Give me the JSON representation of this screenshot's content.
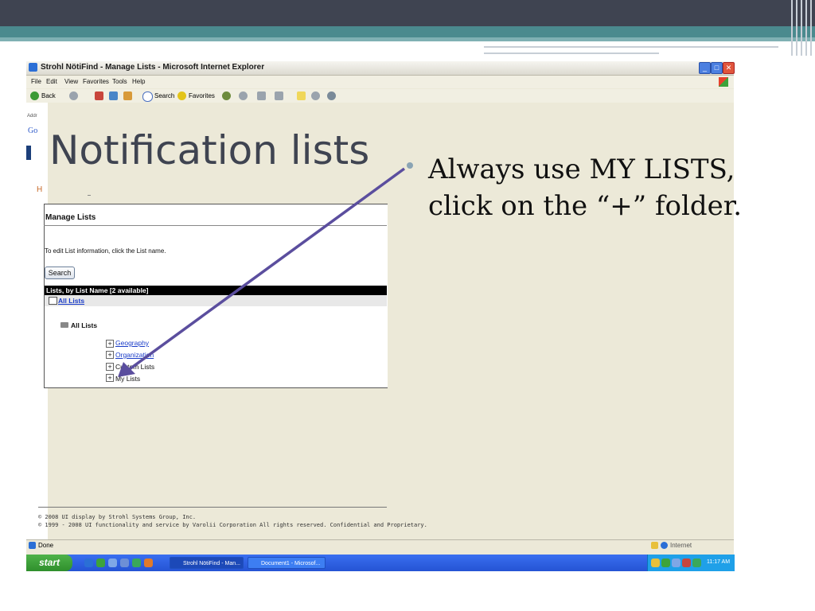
{
  "slide": {
    "title": "Notification lists",
    "bullet": "Always use MY LISTS, click on the “+” folder."
  },
  "window": {
    "title": "Strohl NötiFind - Manage Lists - Microsoft Internet Explorer",
    "menu": [
      "File",
      "Edit",
      "View",
      "Favorites",
      "Tools",
      "Help"
    ],
    "toolbar": {
      "back": "Back",
      "search": "Search",
      "favorites": "Favorites"
    },
    "left_strip": {
      "address": "Addr",
      "google": "Go",
      "h": "H"
    },
    "status": "Done",
    "zone": "Internet"
  },
  "page": {
    "heading": "Manage Lists",
    "instruction": "To edit List information, click the List name.",
    "search_button": "Search",
    "list_header": "Lists, by List Name [2 available]",
    "all_lists_link": "All Lists",
    "all_lists_label": "All Lists",
    "items": [
      {
        "label": "Geography",
        "link": true
      },
      {
        "label": "Organization",
        "link": true
      },
      {
        "label": "Custom Lists",
        "link": false
      },
      {
        "label": "My Lists",
        "link": false
      }
    ],
    "copyright1": "© 2008 UI display by Strohl Systems Group, Inc.",
    "copyright2": "© 1999 - 2008 UI functionality and service by Varolii Corporation All rights reserved. Confidential and Proprietary."
  },
  "taskbar": {
    "start": "start",
    "buttons": [
      "Strohl NötiFind - Man...",
      "Document1 - Microsof..."
    ],
    "clock": "11:17 AM"
  },
  "colors": {
    "slide_dark": "#3f4451",
    "slide_teal": "#4b8a8e",
    "arrow": "#5b4e9e",
    "link": "#1a3cc8",
    "taskbar": "#2553d4"
  }
}
